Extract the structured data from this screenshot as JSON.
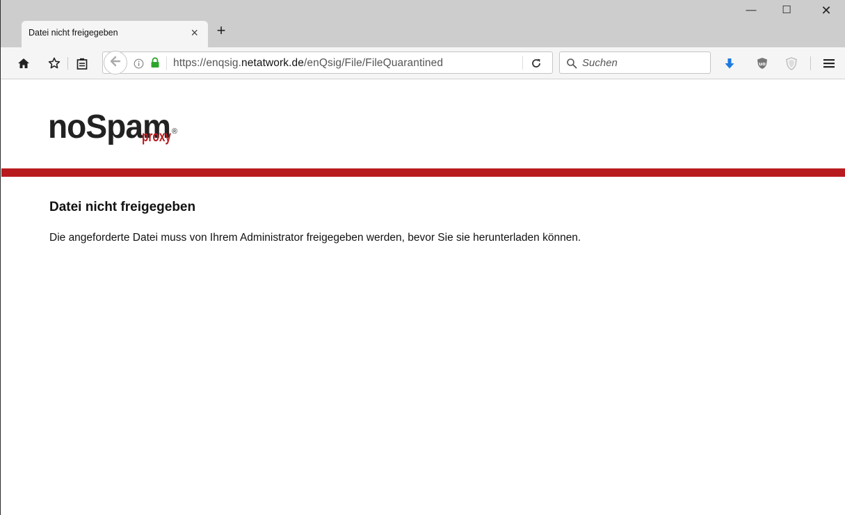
{
  "browser": {
    "tab": {
      "title": "Datei nicht freigegeben",
      "close_glyph": "×"
    },
    "new_tab_glyph": "+",
    "window_controls": {
      "minimize": "—",
      "maximize": "☐",
      "close": "✕"
    },
    "url": {
      "prefix": "https://enqsig.",
      "domain": "netatwork.de",
      "path": "/enQsig/File/FileQuarantined"
    },
    "search_placeholder": "Suchen",
    "icons": [
      "home-icon",
      "bookmark-star-icon",
      "reader-view-icon",
      "back-arrow-icon",
      "info-icon",
      "lock-icon",
      "reload-icon",
      "search-icon",
      "download-icon",
      "ublock-icon",
      "shield-icon",
      "menu-icon"
    ]
  },
  "page": {
    "logo": {
      "main": "noSpam",
      "sub": "proxy",
      "mark": "®"
    },
    "heading": "Datei nicht freigegeben",
    "message": "Die angeforderte Datei muss von Ihrem Administrator freigegeben werden, bevor Sie sie herunterladen können."
  },
  "colors": {
    "brand_red": "#b81b1e",
    "logo_dark": "#222222",
    "download_blue": "#1f7ae0",
    "lock_green": "#2da52d"
  }
}
